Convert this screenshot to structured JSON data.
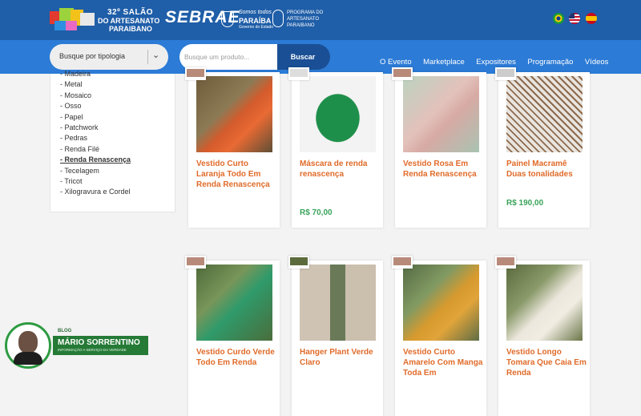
{
  "header": {
    "logo_line1": "32º SALÃO",
    "logo_line2": "DO ARTESANATO",
    "logo_line3": "PARAIBANO",
    "sebrae": "SEBRAE",
    "gov_line1": "Somos todos",
    "gov_line2": "PARAÍBA",
    "gov_line3": "Governo do Estado",
    "programa": "PROGRAMA DO\nARTESANATO\nPARAIBANO"
  },
  "nav": {
    "typology_select": "Busque por tipologia",
    "search_placeholder": "Busque um produto...",
    "search_button": "Buscar",
    "menu": [
      "O Evento",
      "Marketplace",
      "Expositores",
      "Programação",
      "Vídeos"
    ]
  },
  "sidebar": {
    "items": [
      "Madeira",
      "Metal",
      "Mosaico",
      "Osso",
      "Papel",
      "Patchwork",
      "Pedras",
      "Renda Filé",
      "Renda Renascença",
      "Tecelagem",
      "Tricot",
      "Xilogravura e Cordel"
    ],
    "active": "Renda Renascença"
  },
  "products": [
    {
      "title": "Vestido Curto Laranja Todo Em Renda Renascença",
      "price": ""
    },
    {
      "title": "Máscara de renda renascença",
      "price": "R$ 70,00"
    },
    {
      "title": "Vestido Rosa Em Renda Renascença",
      "price": ""
    },
    {
      "title": "Painel Macramê Duas tonalidades",
      "price": "R$ 190,00"
    },
    {
      "title": "Vestido Curdo Verde Todo Em Renda",
      "price": ""
    },
    {
      "title": "Hanger Plant Verde Claro",
      "price": ""
    },
    {
      "title": "Vestido Curto Amarelo Com Manga Toda Em",
      "price": ""
    },
    {
      "title": "Vestido Longo Tomara Que Caia Em Renda",
      "price": ""
    }
  ],
  "blog": {
    "label": "BLOG",
    "name": "MÁRIO SORRENTINO",
    "tagline": "INFORMAÇÃO A SERVIÇO DA VERDADE"
  }
}
